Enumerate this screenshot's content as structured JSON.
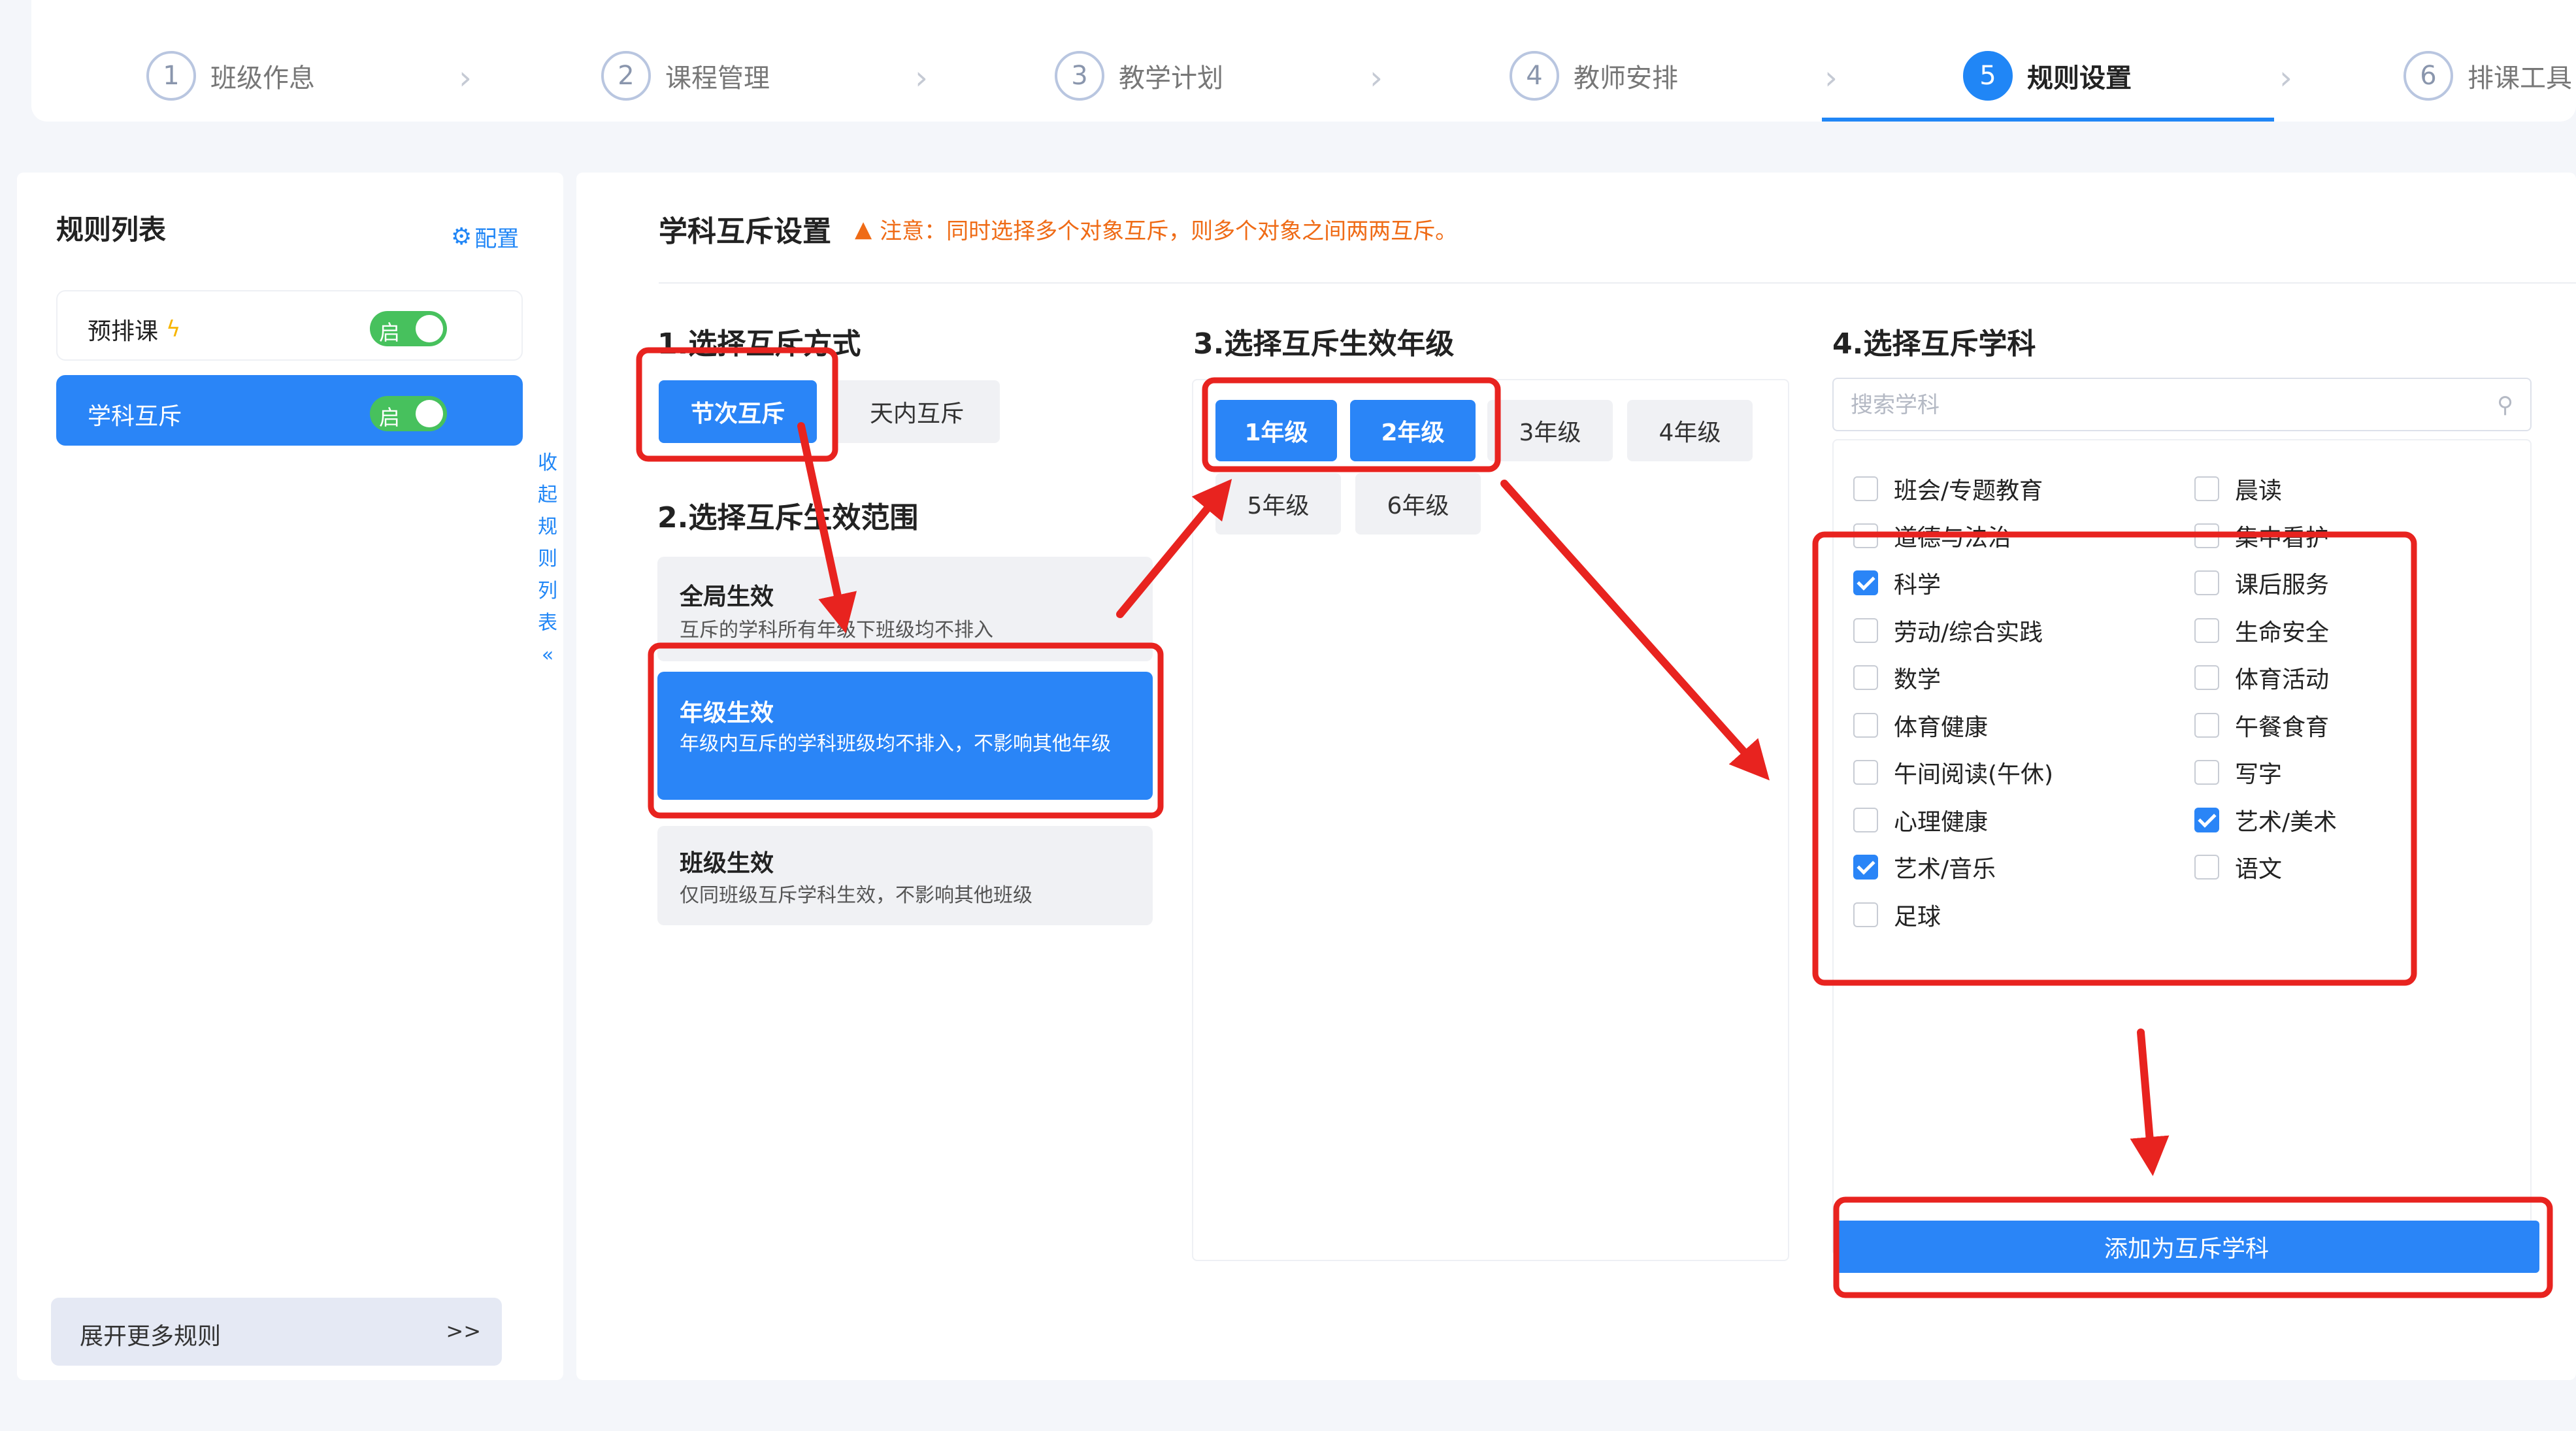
{
  "steps": [
    {
      "num": "1",
      "label": "班级作息"
    },
    {
      "num": "2",
      "label": "课程管理"
    },
    {
      "num": "3",
      "label": "教学计划"
    },
    {
      "num": "4",
      "label": "教师安排"
    },
    {
      "num": "5",
      "label": "规则设置"
    },
    {
      "num": "6",
      "label": "排课工具"
    }
  ],
  "active_step": "5",
  "sidebar": {
    "title": "规则列表",
    "config_label": "配置",
    "items": [
      {
        "label": "预排课",
        "toggle": "启",
        "enabled": true
      },
      {
        "label": "学科互斥",
        "toggle": "启",
        "enabled": true
      }
    ],
    "collapse_chars": [
      "收",
      "起",
      "规",
      "则",
      "列",
      "表"
    ],
    "collapse_arrow": "«",
    "expand_more": "展开更多规则",
    "expand_arrow": ">>"
  },
  "main": {
    "title": "学科互斥设置",
    "notice": "注意：同时选择多个对象互斥，则多个对象之间两两互斥。",
    "step1_title": "1.选择互斥方式",
    "step1_options": [
      "节次互斥",
      "天内互斥"
    ],
    "step2_title": "2.选择互斥生效范围",
    "scopes": [
      {
        "title": "全局生效",
        "desc": "互斥的学科所有年级下班级均不排入"
      },
      {
        "title": "年级生效",
        "desc": "年级内互斥的学科班级均不排入，不影响其他年级"
      },
      {
        "title": "班级生效",
        "desc": "仅同班级互斥学科生效，不影响其他班级"
      }
    ],
    "step3_title": "3.选择互斥生效年级",
    "grades": [
      "1年级",
      "2年级",
      "3年级",
      "4年级",
      "5年级",
      "6年级"
    ],
    "step4_title": "4.选择互斥学科",
    "search_placeholder": "搜索学科",
    "subjects_left": [
      {
        "label": "班会/专题教育",
        "checked": false
      },
      {
        "label": "道德与法治",
        "checked": false
      },
      {
        "label": "科学",
        "checked": true
      },
      {
        "label": "劳动/综合实践",
        "checked": false
      },
      {
        "label": "数学",
        "checked": false
      },
      {
        "label": "体育健康",
        "checked": false
      },
      {
        "label": "午间阅读(午休)",
        "checked": false
      },
      {
        "label": "心理健康",
        "checked": false
      },
      {
        "label": "艺术/音乐",
        "checked": true
      },
      {
        "label": "足球",
        "checked": false
      }
    ],
    "subjects_right": [
      {
        "label": "晨读",
        "checked": false
      },
      {
        "label": "集中看护",
        "checked": false
      },
      {
        "label": "课后服务",
        "checked": false
      },
      {
        "label": "生命安全",
        "checked": false
      },
      {
        "label": "体育活动",
        "checked": false
      },
      {
        "label": "午餐食育",
        "checked": false
      },
      {
        "label": "写字",
        "checked": false
      },
      {
        "label": "艺术/美术",
        "checked": true
      },
      {
        "label": "语文",
        "checked": false
      }
    ],
    "add_button": "添加为互斥学科"
  },
  "colors": {
    "accent": "#2a85f7",
    "toggle_on": "#47c15d",
    "warning": "#ef6b16",
    "annotation": "#e8231f"
  }
}
